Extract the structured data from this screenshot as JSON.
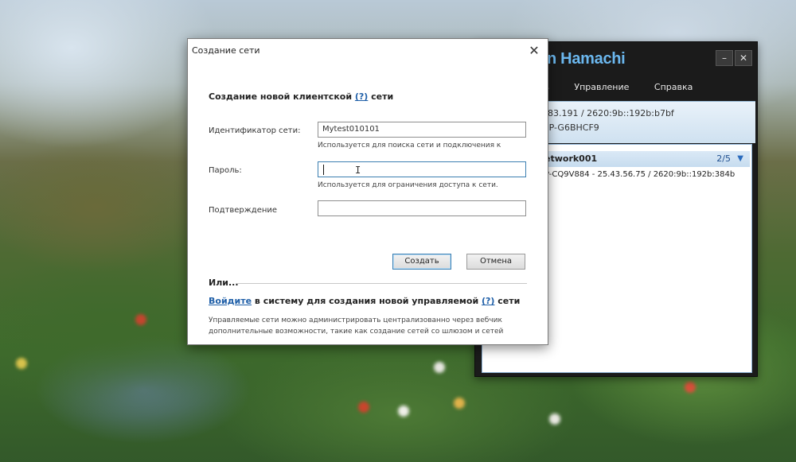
{
  "hamachi": {
    "title": "n Hamachi",
    "minimize": "–",
    "close": "✕",
    "menu": [
      "ть",
      "Управление",
      "Справка"
    ],
    "ip_line1": "183.191 / 2620:9b::192b:b7bf",
    "ip_line2": "OP-G6BHCF9",
    "network": {
      "name": "etwork001",
      "count": "2/5",
      "arrow": "▼",
      "peer": "P-CQ9V884 - 25.43.56.75 / 2620:9b::192b:384b"
    }
  },
  "dialog": {
    "title": "Создание сети",
    "close": "✕",
    "heading_prefix": "Создание новой клиентской ",
    "heading_help": "(?)",
    "heading_suffix": " сети",
    "network_id_label": "Идентификатор сети:",
    "network_id_value": "Mytest010101",
    "network_id_hint": "Используется для поиска сети и подключения к",
    "password_label": "Пароль:",
    "password_hint": "Используется для ограничения доступа к сети.",
    "confirm_label": "Подтверждение",
    "create_button": "Создать",
    "cancel_button": "Отмена",
    "or_label": "Или...",
    "login_link": "Войдите",
    "login_text": " в систему для создания новой управляемой ",
    "login_help": "(?)",
    "login_suffix": " сети",
    "description": "Управляемые сети можно администрировать централизованно через вебчик дополнительные возможности, такие как создание сетей со шлюзом и сетей"
  }
}
